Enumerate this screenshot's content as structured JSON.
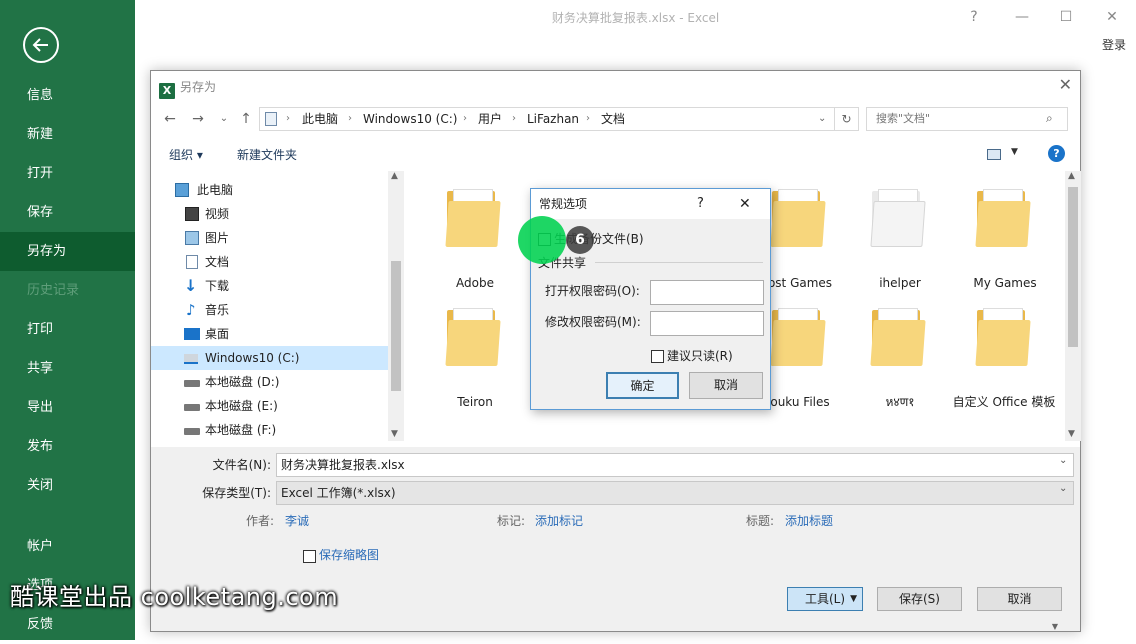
{
  "window": {
    "title": "财务决算批复报表.xlsx - Excel",
    "help": "?",
    "login": "登录"
  },
  "sidebar": {
    "items": [
      {
        "label": "信息"
      },
      {
        "label": "新建"
      },
      {
        "label": "打开"
      },
      {
        "label": "保存"
      },
      {
        "label": "另存为"
      },
      {
        "label": "历史记录"
      },
      {
        "label": "打印"
      },
      {
        "label": "共享"
      },
      {
        "label": "导出"
      },
      {
        "label": "发布"
      },
      {
        "label": "关闭"
      },
      {
        "label": "帐户"
      },
      {
        "label": "选项"
      },
      {
        "label": "反馈"
      }
    ]
  },
  "dialog": {
    "title": "另存为",
    "xl_letter": "X",
    "breadcrumb": [
      "此电脑",
      "Windows10 (C:)",
      "用户",
      "LiFazhan",
      "文档"
    ],
    "search_placeholder": "搜索\"文档\"",
    "organize": "组织 ▾",
    "new_folder": "新建文件夹",
    "help": "?",
    "tree": [
      {
        "label": "此电脑"
      },
      {
        "label": "视频"
      },
      {
        "label": "图片"
      },
      {
        "label": "文档"
      },
      {
        "label": "下载"
      },
      {
        "label": "音乐"
      },
      {
        "label": "桌面"
      },
      {
        "label": "Windows10 (C:)"
      },
      {
        "label": "本地磁盘 (D:)"
      },
      {
        "label": "本地磁盘 (E:)"
      },
      {
        "label": "本地磁盘 (F:)"
      }
    ],
    "folders": [
      {
        "label": "Adobe"
      },
      {
        "label": "ost Games"
      },
      {
        "label": "ihelper"
      },
      {
        "label": "My Games"
      },
      {
        "label": "Teiron"
      },
      {
        "label": "ouku Files"
      },
      {
        "label": "ห४ण१"
      },
      {
        "label": "自定义 Office 模板"
      }
    ],
    "filename_label": "文件名(N):",
    "filename_value": "财务决算批复报表.xlsx",
    "filetype_label": "保存类型(T):",
    "filetype_value": "Excel 工作簿(*.xlsx)",
    "author_label": "作者:",
    "author_value": "李诚",
    "tags_label": "标记:",
    "tags_value": "添加标记",
    "title_label": "标题:",
    "title_value": "添加标题",
    "thumbnail_label": "保存缩略图",
    "tools_label": "工具(L)",
    "save_label": "保存(S)",
    "cancel_label": "取消"
  },
  "popup": {
    "title": "常规选项",
    "help": "?",
    "backup_label": "生成备份文件(B)",
    "sharing_header": "文件共享",
    "open_pwd_label": "打开权限密码(O):",
    "modify_pwd_label": "修改权限密码(M):",
    "readonly_label": "建议只读(R)",
    "ok_label": "确定",
    "cancel_label": "取消"
  },
  "cursor": {
    "step": "6"
  },
  "watermark": "酷课堂出品 coolketang.com",
  "colors": {
    "sidebar": "#217346",
    "accent": "#0e5c2f",
    "link": "#2b6cb8",
    "highlight": "#00d250"
  }
}
